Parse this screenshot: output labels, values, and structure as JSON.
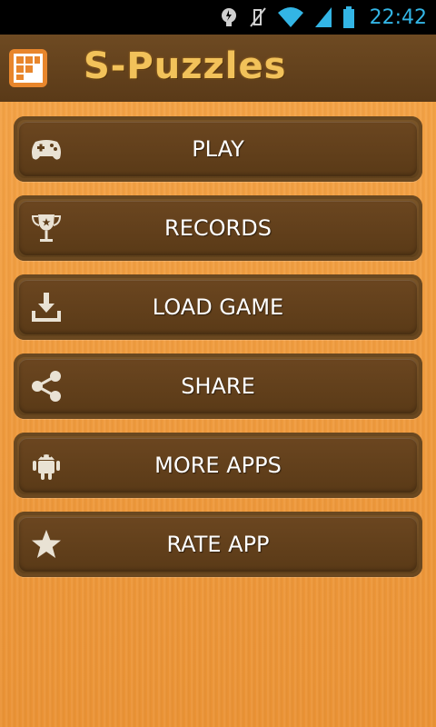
{
  "status_bar": {
    "time": "22:42",
    "icons": [
      "location-icon",
      "muted-icon",
      "wifi-icon",
      "signal-icon",
      "battery-icon"
    ]
  },
  "app_bar": {
    "title": "S-Puzzles",
    "logo_icon": "puzzle-grid-icon",
    "title_color": "#f2c25a"
  },
  "menu": {
    "items": [
      {
        "label": "PLAY",
        "icon": "gamepad-icon"
      },
      {
        "label": "RECORDS",
        "icon": "trophy-icon"
      },
      {
        "label": "LOAD GAME",
        "icon": "download-icon"
      },
      {
        "label": "SHARE",
        "icon": "share-icon"
      },
      {
        "label": "MORE APPS",
        "icon": "android-icon"
      },
      {
        "label": "RATE APP",
        "icon": "star-icon"
      }
    ]
  },
  "colors": {
    "background": "#f0a040",
    "button": "#6b4620",
    "action_bar": "#6e4a22",
    "time": "#33b5e5"
  }
}
